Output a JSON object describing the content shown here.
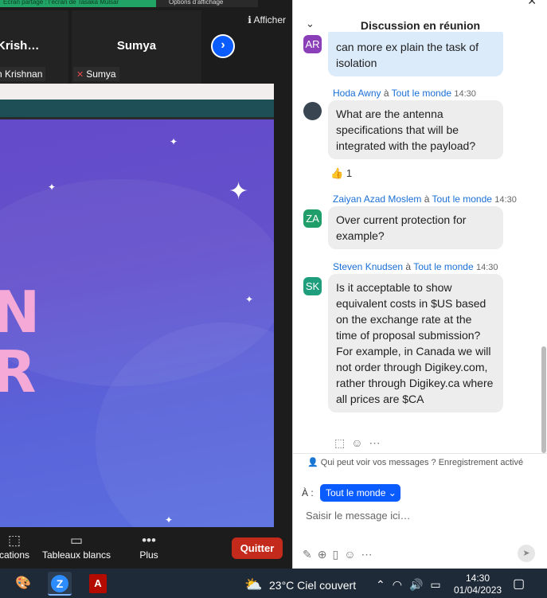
{
  "top_strip": {
    "left_text": "Écran partagé : l’écran de Tasaka Mulsar",
    "right_text": "Options d’affichage"
  },
  "participants": [
    {
      "name": "Krish…",
      "tag": "n Krishnan"
    },
    {
      "name": "Sumya",
      "tag": "Sumya"
    }
  ],
  "afficher_label": "Afficher",
  "slide": {
    "letters": [
      "N",
      "R"
    ]
  },
  "toolbar": {
    "items": [
      {
        "label": "cations",
        "icon": "apps-icon"
      },
      {
        "label": "Tableaux blancs",
        "icon": "whiteboard-icon"
      },
      {
        "label": "Plus",
        "icon": "more-icon"
      }
    ],
    "quit_label": "Quitter"
  },
  "chat": {
    "title": "Discussion en réunion",
    "messages": [
      {
        "initials": "AR",
        "avatar_color": "#8a3fb8",
        "text": "can more ex plain the task of isolation",
        "mine": true
      },
      {
        "sender": "Hoda Awny",
        "to_word": "à",
        "recipient": "Tout le monde",
        "time": "14:30",
        "text": "What are the antenna specifications that will be integrated with the payload?",
        "reaction_emoji": "👍",
        "reaction_count": "1"
      },
      {
        "sender": "Zaiyan Azad Moslem",
        "to_word": "à",
        "recipient": "Tout le monde",
        "time": "14:30",
        "initials": "ZA",
        "avatar_color": "#1f9e6a",
        "text": "Over current protection for example?"
      },
      {
        "sender": "Steven Knudsen",
        "to_word": "à",
        "recipient": "Tout le monde",
        "time": "14:30",
        "initials": "SK",
        "avatar_color": "#1f9e7e",
        "text": "Is it acceptable to show equivalent costs in $US based on the exchange rate at the time of proposal submission? For example, in Canada we will not order through Digikey.com, rather through Digikey.ca where all prices are $CA"
      }
    ],
    "privacy_text": "Qui peut voir vos messages ? Enregistrement activé",
    "to_label": "À :",
    "to_value": "Tout le monde",
    "input_placeholder": "Saisir le message ici…"
  },
  "taskbar": {
    "weather": "23°C  Ciel couvert",
    "time": "14:30",
    "date": "01/04/2023"
  },
  "colors": {
    "zoom_blue": "#0b5cff",
    "quit_red": "#c42a1b",
    "slide_purple": "#6349c8",
    "slide_pink": "#f4a9d7"
  }
}
